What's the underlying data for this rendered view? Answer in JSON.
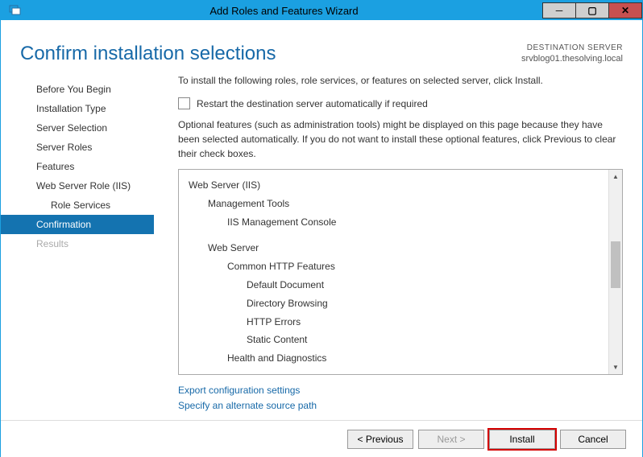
{
  "window": {
    "title": "Add Roles and Features Wizard"
  },
  "header": {
    "page_title": "Confirm installation selections",
    "dest_label": "DESTINATION SERVER",
    "dest_server": "srvblog01.thesolving.local"
  },
  "nav": {
    "items": [
      {
        "label": "Before You Begin",
        "level": 0,
        "active": false,
        "disabled": false
      },
      {
        "label": "Installation Type",
        "level": 0,
        "active": false,
        "disabled": false
      },
      {
        "label": "Server Selection",
        "level": 0,
        "active": false,
        "disabled": false
      },
      {
        "label": "Server Roles",
        "level": 0,
        "active": false,
        "disabled": false
      },
      {
        "label": "Features",
        "level": 0,
        "active": false,
        "disabled": false
      },
      {
        "label": "Web Server Role (IIS)",
        "level": 0,
        "active": false,
        "disabled": false
      },
      {
        "label": "Role Services",
        "level": 1,
        "active": false,
        "disabled": false
      },
      {
        "label": "Confirmation",
        "level": 0,
        "active": true,
        "disabled": false
      },
      {
        "label": "Results",
        "level": 0,
        "active": false,
        "disabled": true
      }
    ]
  },
  "main": {
    "instruction": "To install the following roles, role services, or features on selected server, click Install.",
    "restart_checkbox_label": "Restart the destination server automatically if required",
    "restart_checked": false,
    "note": "Optional features (such as administration tools) might be displayed on this page because they have been selected automatically. If you do not want to install these optional features, click Previous to clear their check boxes.",
    "tree": [
      {
        "label": "Web Server (IIS)",
        "level": 0
      },
      {
        "label": "Management Tools",
        "level": 1
      },
      {
        "label": "IIS Management Console",
        "level": 2
      },
      {
        "label": "Web Server",
        "level": 1
      },
      {
        "label": "Common HTTP Features",
        "level": 2
      },
      {
        "label": "Default Document",
        "level": 3
      },
      {
        "label": "Directory Browsing",
        "level": 3
      },
      {
        "label": "HTTP Errors",
        "level": 3
      },
      {
        "label": "Static Content",
        "level": 3
      },
      {
        "label": "Health and Diagnostics",
        "level": 2
      }
    ],
    "link_export": "Export configuration settings",
    "link_altpath": "Specify an alternate source path"
  },
  "footer": {
    "previous": "< Previous",
    "next": "Next >",
    "install": "Install",
    "cancel": "Cancel"
  }
}
